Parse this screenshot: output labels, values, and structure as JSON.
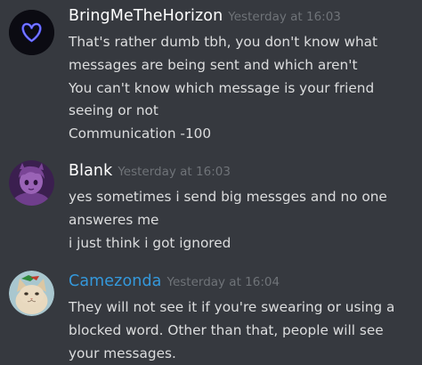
{
  "messages": [
    {
      "username": "BringMeTheHorizon",
      "username_color": "#ffffff",
      "timestamp": "Yesterday at 16:03",
      "avatar_icon": "heart-icon",
      "lines": [
        "That's rather dumb tbh, you don't know what",
        "messages are being sent and which aren't",
        "You can't know which message is your friend",
        "seeing or not",
        "Communication -100"
      ]
    },
    {
      "username": "Blank",
      "username_color": "#ffffff",
      "timestamp": "Yesterday at 16:03",
      "avatar_icon": "anime-character-avatar",
      "lines": [
        "yes sometimes i send big messges and no one",
        "answeres me",
        "i just think i got ignored"
      ]
    },
    {
      "username": "Camezonda",
      "username_color": "#3498db",
      "timestamp": "Yesterday at 16:04",
      "avatar_icon": "cat-avatar",
      "lines": [
        "They will not see it if you're swearing or using a",
        "blocked word. Other than that, people will see",
        "your messages."
      ]
    }
  ]
}
